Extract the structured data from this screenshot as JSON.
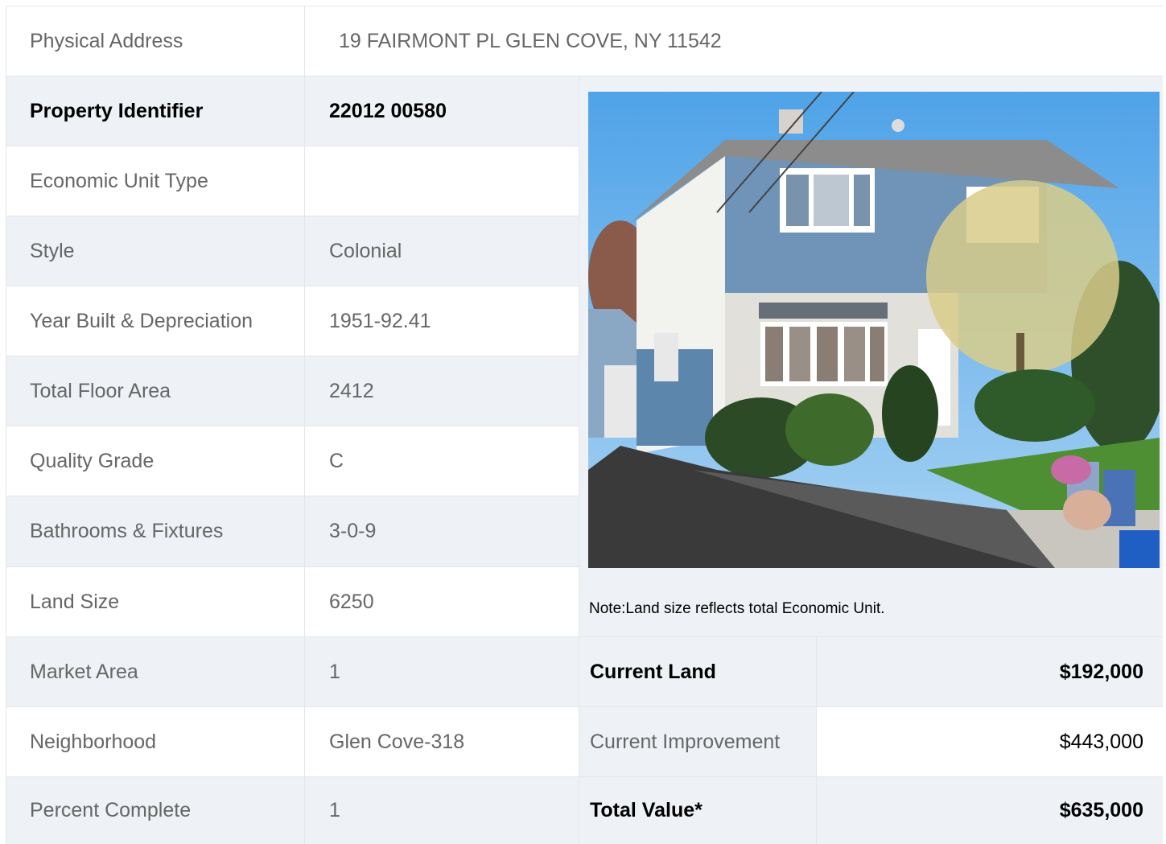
{
  "address": {
    "label": "Physical Address",
    "value": "19  FAIRMONT PL  GLEN COVE, NY  11542"
  },
  "details": [
    {
      "label": "Property Identifier",
      "value": "22012  00580"
    },
    {
      "label": "Economic Unit Type",
      "value": ""
    },
    {
      "label": "Style",
      "value": "Colonial"
    },
    {
      "label": "Year Built & Depreciation",
      "value": "1951-92.41"
    },
    {
      "label": "Total Floor Area",
      "value": "2412"
    },
    {
      "label": "Quality Grade",
      "value": "C"
    },
    {
      "label": "Bathrooms & Fixtures",
      "value": "3-0-9"
    },
    {
      "label": "Land Size",
      "value": "6250"
    },
    {
      "label": "Market Area",
      "value": "1"
    },
    {
      "label": "Neighborhood",
      "value": "Glen Cove-318"
    },
    {
      "label": "Percent Complete",
      "value": "1"
    }
  ],
  "note": "Note:Land size reflects total Economic Unit.",
  "valuation": [
    {
      "label": "Current Land",
      "value": "$192,000"
    },
    {
      "label": "Current Improvement",
      "value": "$443,000"
    },
    {
      "label": "Total Value*",
      "value": "$635,000"
    }
  ],
  "colors": {
    "row_shade": "#eef1f5",
    "border": "#e3e6ea",
    "text": "#666666",
    "bold_text": "#000000"
  }
}
